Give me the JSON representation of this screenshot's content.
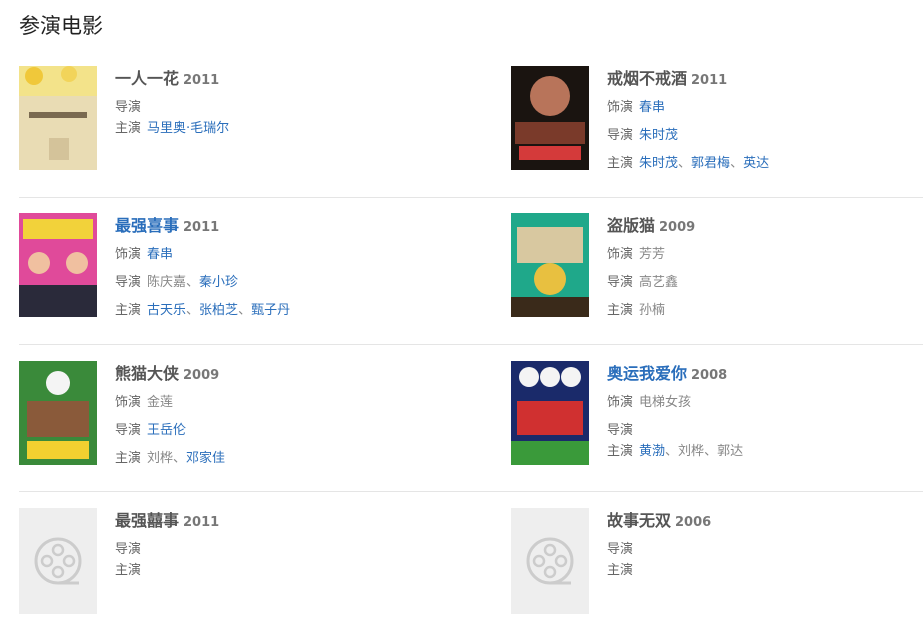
{
  "section_title": "参演电影",
  "films": {
    "f1": {
      "name": "一人一花",
      "year": "2011",
      "director_label": "导演",
      "cast_label": "主演",
      "cast_0": "马里奥·毛瑞尔"
    },
    "f2": {
      "name": "戒烟不戒酒",
      "year": "2011",
      "role_label": "饰演",
      "role": "春串",
      "director_label": "导演",
      "director_0": "朱时茂",
      "cast_label": "主演",
      "cast_0": "朱时茂",
      "cast_1": "郭君梅",
      "cast_2": "英达"
    },
    "f3": {
      "name": "最强喜事",
      "year": "2011",
      "role_label": "饰演",
      "role": "春串",
      "director_label": "导演",
      "director_0": "陈庆嘉",
      "director_1": "秦小珍",
      "cast_label": "主演",
      "cast_0": "古天乐",
      "cast_1": "张柏芝",
      "cast_2": "甄子丹"
    },
    "f4": {
      "name": "盗版猫",
      "year": "2009",
      "role_label": "饰演",
      "role": "芳芳",
      "director_label": "导演",
      "director_0": "高艺鑫",
      "cast_label": "主演",
      "cast_0": "孙楠"
    },
    "f5": {
      "name": "熊猫大侠",
      "year": "2009",
      "role_label": "饰演",
      "role": "金莲",
      "director_label": "导演",
      "director_0": "王岳伦",
      "cast_label": "主演",
      "cast_0": "刘桦",
      "cast_1": "邓家佳"
    },
    "f6": {
      "name": "奥运我爱你",
      "year": "2008",
      "role_label": "饰演",
      "role": "电梯女孩",
      "director_label": "导演",
      "cast_label": "主演",
      "cast_0": "黄渤",
      "cast_1": "刘桦",
      "cast_2": "郭达"
    },
    "f7": {
      "name": "最强囍事",
      "year": "2011",
      "director_label": "导演",
      "cast_label": "主演"
    },
    "f8": {
      "name": "故事无双",
      "year": "2006",
      "director_label": "导演",
      "cast_label": "主演"
    }
  },
  "separator": "、",
  "colors": {
    "link": "#2a6ebb",
    "title": "#555555",
    "muted": "#888888",
    "divider": "#e5e5e5"
  },
  "icons": {
    "placeholder": "film-reel-icon"
  }
}
